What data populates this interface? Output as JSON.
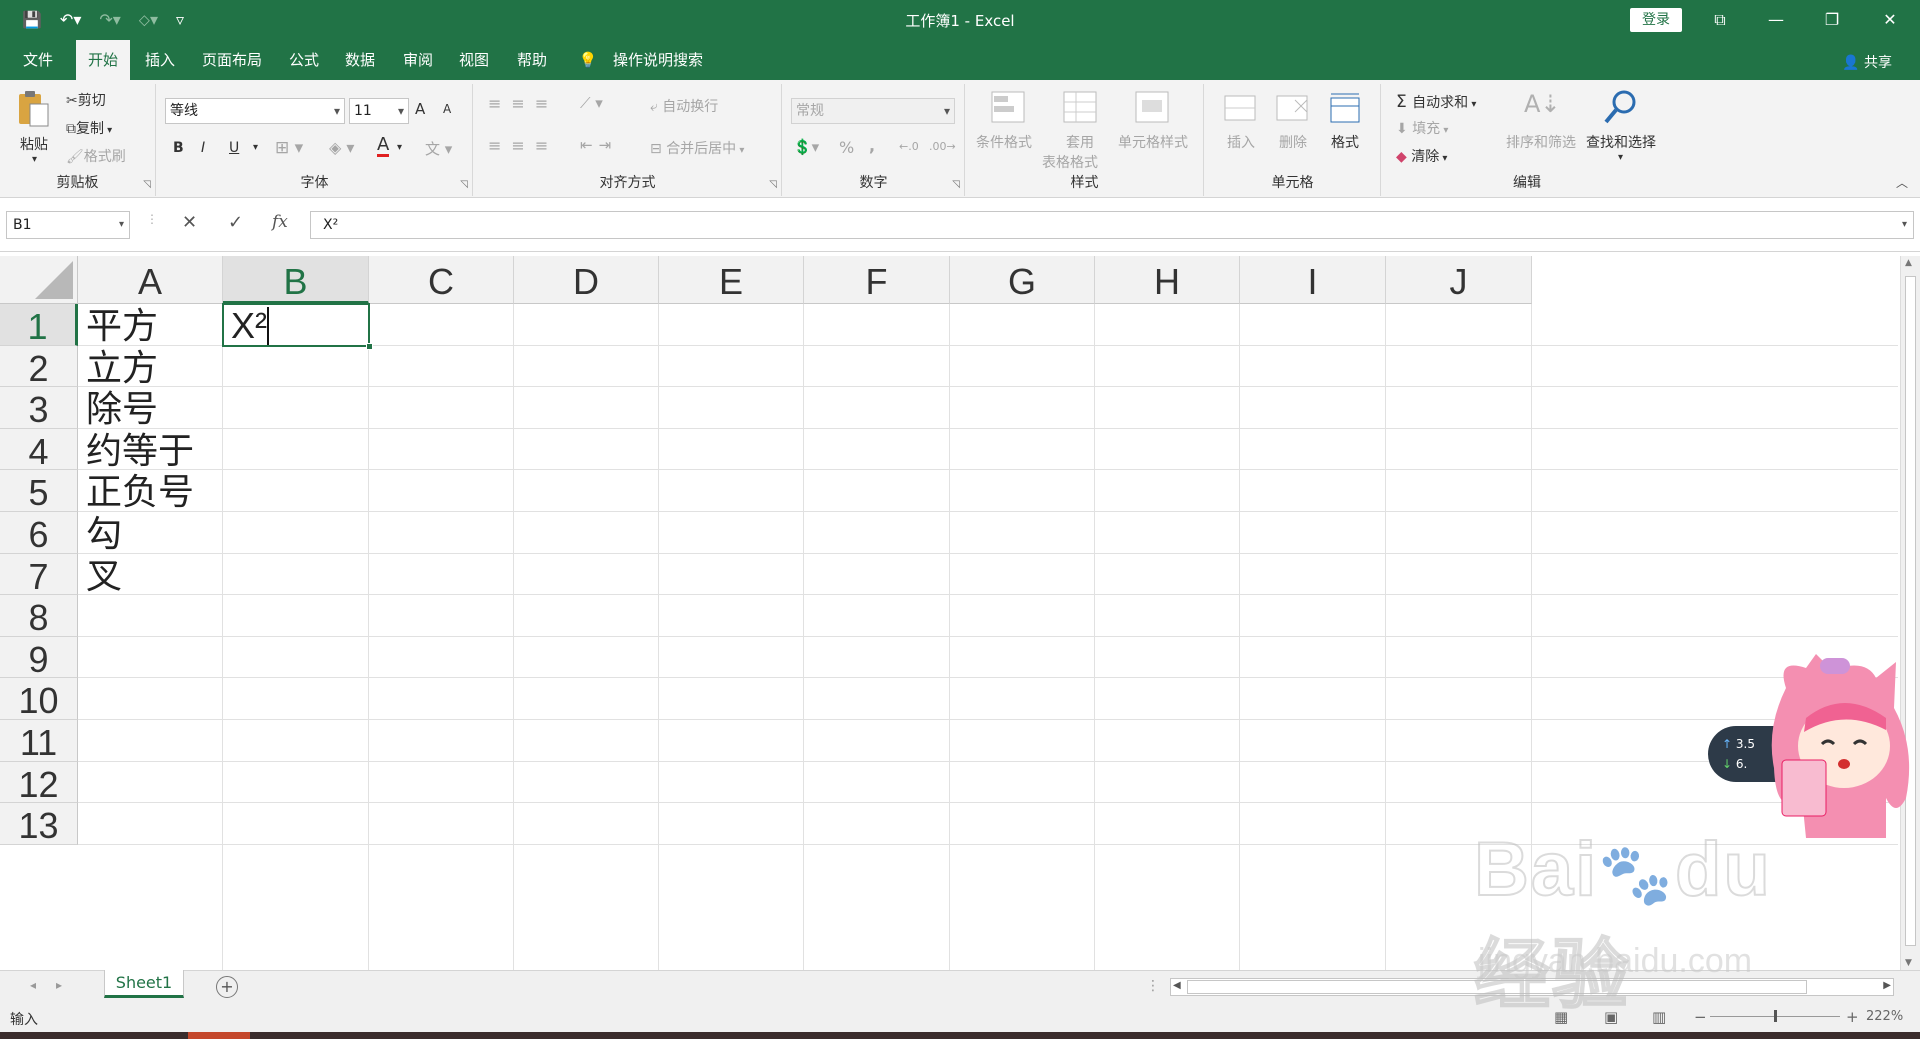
{
  "window": {
    "title": "工作簿1 - Excel",
    "login_label": "登录",
    "share_label": "共享"
  },
  "menu": {
    "tabs": [
      "文件",
      "开始",
      "插入",
      "页面布局",
      "公式",
      "数据",
      "审阅",
      "视图",
      "帮助"
    ],
    "active_tab": "开始",
    "tell_me": "操作说明搜索"
  },
  "ribbon": {
    "clipboard": {
      "label": "剪贴板",
      "paste": "粘贴",
      "cut": "剪切",
      "copy": "复制",
      "format_painter": "格式刷"
    },
    "font": {
      "label": "字体",
      "font_name": "等线",
      "font_size": "11",
      "bold": "B",
      "italic": "I",
      "underline": "U",
      "grow": "A",
      "shrink": "A",
      "color": "A"
    },
    "alignment": {
      "label": "对齐方式",
      "wrap": "自动换行",
      "merge": "合并后居中"
    },
    "number": {
      "label": "数字",
      "format": "常规",
      "percent": "%",
      "comma": ","
    },
    "styles": {
      "label": "样式",
      "conditional": "条件格式",
      "table_line1": "套用",
      "table_line2": "表格格式",
      "cell_styles": "单元格样式"
    },
    "cells": {
      "label": "单元格",
      "insert": "插入",
      "delete": "删除",
      "format": "格式"
    },
    "editing": {
      "label": "编辑",
      "autosum": "自动求和",
      "fill": "填充",
      "clear": "清除",
      "sort": "排序和筛选",
      "find": "查找和选择"
    }
  },
  "formula_bar": {
    "name_box": "B1",
    "fx": "fx",
    "content": "X²"
  },
  "sheet": {
    "columns": [
      "A",
      "B",
      "C",
      "D",
      "E",
      "F",
      "G",
      "H",
      "I",
      "J"
    ],
    "rows": [
      "1",
      "2",
      "3",
      "4",
      "5",
      "6",
      "7",
      "8",
      "9",
      "10",
      "11",
      "12",
      "13"
    ],
    "selected_column": "B",
    "selected_row": "1",
    "column_a_values": [
      "平方",
      "立方",
      "除号",
      "约等于",
      "正负号",
      "勾",
      "叉"
    ],
    "b1_value": "X²"
  },
  "tabs_bar": {
    "sheet_name": "Sheet1",
    "add_sheet": "+"
  },
  "status": {
    "mode": "输入",
    "zoom": "222%",
    "minus": "−",
    "plus": "+"
  },
  "overlay": {
    "upload_speed": "3.5",
    "download_speed": "6.",
    "watermark_logo": "Bai du 经验",
    "watermark_url": "jingyan.baidu.com"
  },
  "colors": {
    "excel_green": "#217346",
    "ribbon_bg": "#f3f3f3",
    "grid_line": "#e1e1e1"
  }
}
